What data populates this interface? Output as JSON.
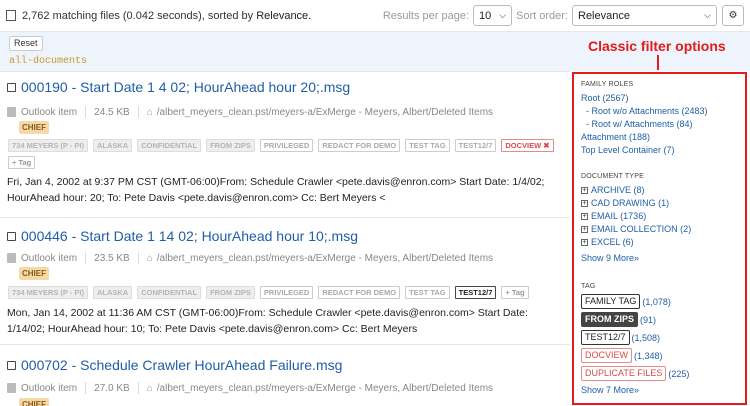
{
  "header": {
    "summary_prefix": "2,762 matching files (0.042 seconds), sorted by",
    "summary_sort": "Relevance.",
    "results_per_page_label": "Results per page:",
    "results_per_page": "10",
    "sort_order_label": "Sort order:",
    "sort_order": "Relevance"
  },
  "filterbar": {
    "reset_label": "Reset",
    "all_documents": "all-documents"
  },
  "annotation": {
    "text": "Classic filter options",
    "color": "#e21b1b"
  },
  "results": [
    {
      "title": "000190 - Start Date 1 4 02; HourAhead hour 20;.msg",
      "type": "Outlook item",
      "size": "24.5 KB",
      "path": "/albert_meyers_clean.pst/meyers-a/ExMerge - Meyers, Albert/Deleted Items",
      "badge": "CHIEF",
      "tags": [
        "734 MEYERS (P - PI)",
        "ALASKA",
        "CONFIDENTIAL",
        "FROM ZIPS",
        "PRIVILEGED",
        "REDACT FOR DEMO",
        "TEST TAG",
        "TEST12/7",
        "DOCVIEW ✖"
      ],
      "add_tag": "+ Tag",
      "snippet": "Fri, Jan 4, 2002 at 9:37 PM CST (GMT-06:00)From: Schedule Crawler <pete.davis@enron.com> Start Date: 1/4/02; HourAhead hour: 20; To: Pete Davis <pete.davis@enron.com> Cc: Bert Meyers <"
    },
    {
      "title": "000446 - Start Date 1 14 02; HourAhead hour 10;.msg",
      "type": "Outlook item",
      "size": "23.5 KB",
      "path": "/albert_meyers_clean.pst/meyers-a/ExMerge - Meyers, Albert/Deleted Items",
      "badge": "CHIEF",
      "tags": [
        "734 MEYERS (P - PI)",
        "ALASKA",
        "CONFIDENTIAL",
        "FROM ZIPS",
        "PRIVILEGED",
        "REDACT FOR DEMO",
        "TEST TAG",
        "TEST12/7"
      ],
      "add_tag": "+ Tag",
      "snippet": "Mon, Jan 14, 2002 at 11:36 AM CST (GMT-06:00)From: Schedule Crawler <pete.davis@enron.com> Start Date: 1/14/02; HourAhead hour: 10; To: Pete Davis <pete.davis@enron.com> Cc: Bert Meyers"
    },
    {
      "title": "000702 - Schedule Crawler HourAhead Failure.msg",
      "type": "Outlook item",
      "size": "27.0 KB",
      "path": "/albert_meyers_clean.pst/meyers-a/ExMerge - Meyers, Albert/Deleted Items",
      "badge": "CHIEF"
    }
  ],
  "panel": {
    "family_roles_heading": "FAMILY ROLES",
    "family_roles": [
      {
        "label": "Root (2567)",
        "indent": false
      },
      {
        "label": "- Root w/o Attachments (2483)",
        "indent": true
      },
      {
        "label": "- Root w/ Attachments (84)",
        "indent": true
      },
      {
        "label": "Attachment (188)",
        "indent": false
      },
      {
        "label": "Top Level Container (7)",
        "indent": false
      }
    ],
    "doc_type_heading": "DOCUMENT TYPE",
    "doc_types": [
      "ARCHIVE (8)",
      "CAD DRAWING (1)",
      "EMAIL (1736)",
      "EMAIL COLLECTION (2)",
      "EXCEL (6)"
    ],
    "doc_type_more": "Show 9 More»",
    "tag_heading": "TAG",
    "tags": [
      {
        "label": "FAMILY TAG",
        "count": "(1,078)"
      },
      {
        "label": "FROM ZIPS",
        "count": "(91)"
      },
      {
        "label": "TEST12/7",
        "count": "(1,508)"
      },
      {
        "label": "DOCVIEW",
        "count": "(1,348)"
      },
      {
        "label": "DUPLICATE FILES",
        "count": "(225)"
      }
    ],
    "tag_more": "Show 7 More»"
  }
}
